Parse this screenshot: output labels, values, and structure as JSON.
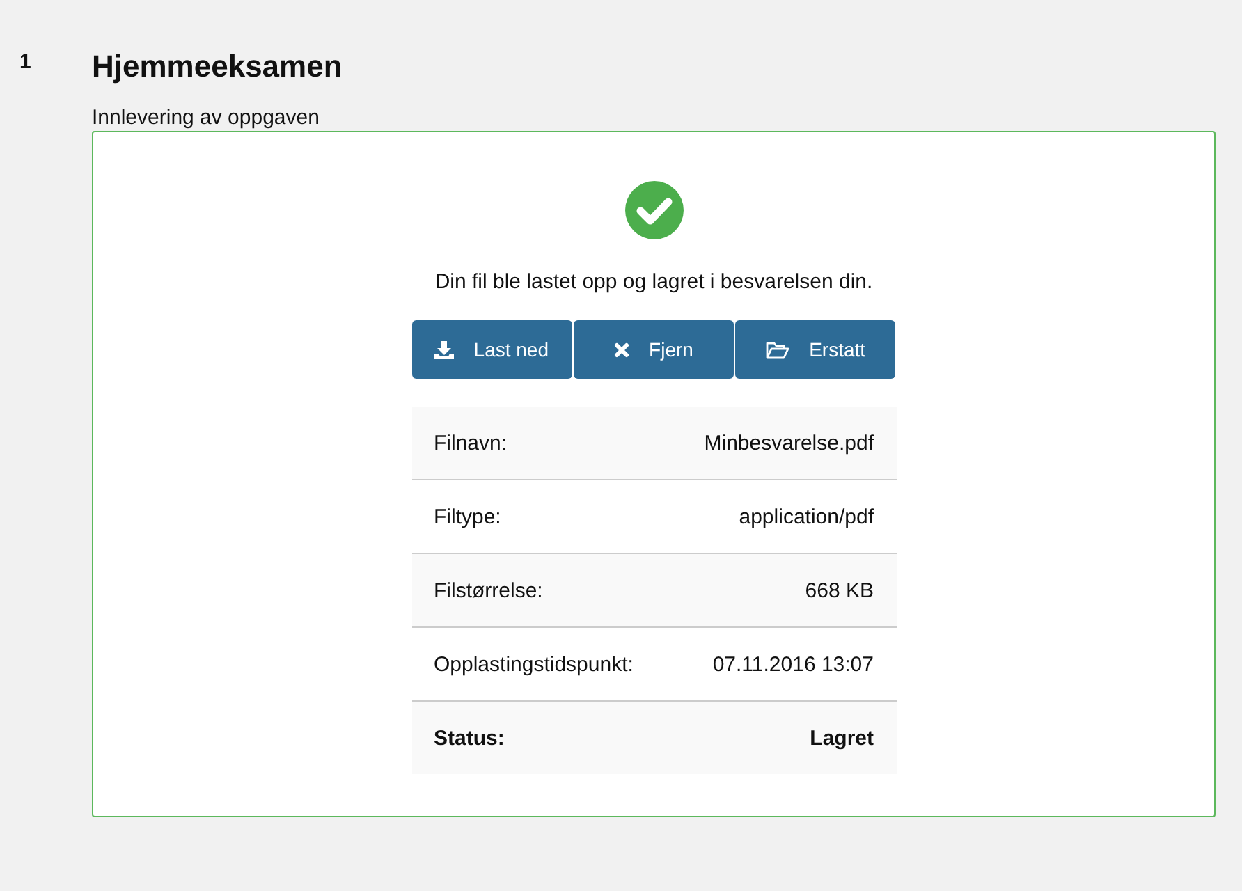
{
  "question": {
    "number": "1",
    "title": "Hjemmeeksamen",
    "subtitle": "Innlevering av oppgaven"
  },
  "upload": {
    "message": "Din fil ble lastet opp og lagret i besvarelsen din.",
    "buttons": [
      {
        "label": "Last ned",
        "kind": "download"
      },
      {
        "label": "Fjern",
        "kind": "remove"
      },
      {
        "label": "Erstatt",
        "kind": "replace"
      }
    ],
    "details": [
      {
        "label": "Filnavn:",
        "value": "Minbesvarelse.pdf",
        "emphasis": false
      },
      {
        "label": "Filtype:",
        "value": "application/pdf",
        "emphasis": false
      },
      {
        "label": "Filstørrelse:",
        "value": "668 KB",
        "emphasis": false
      },
      {
        "label": "Opplastingstidspunkt:",
        "value": "07.11.2016 13:07",
        "emphasis": false
      },
      {
        "label": "Status:",
        "value": "Lagret",
        "emphasis": true
      }
    ]
  }
}
